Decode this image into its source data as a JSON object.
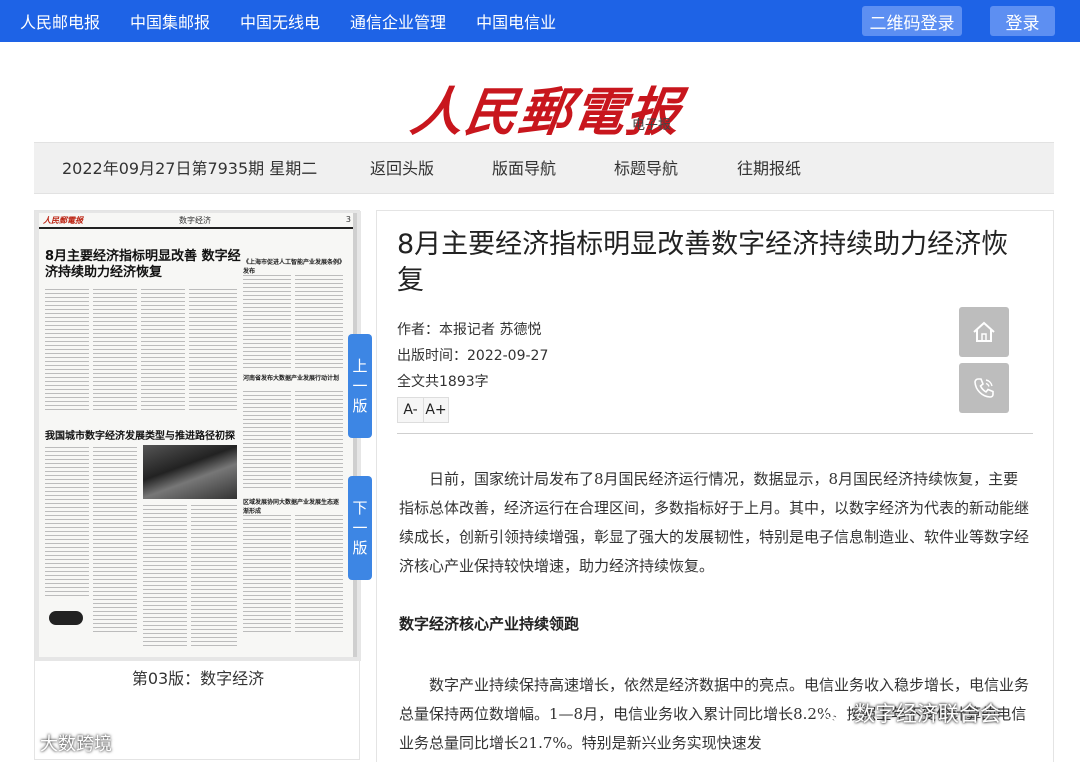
{
  "topnav": {
    "links": [
      "人民邮电报",
      "中国集邮报",
      "中国无线电",
      "通信企业管理",
      "中国电信业"
    ],
    "qr_login": "二维码登录",
    "login": "登录"
  },
  "masthead": {
    "logo": "人民郵電报",
    "subtitle": "电子报"
  },
  "subnav": {
    "issue": "2022年09月27日第7935期 星期二",
    "back_home": "返回头版",
    "layout_nav": "版面导航",
    "title_nav": "标题导航",
    "archive": "往期报纸"
  },
  "newspaper": {
    "section": "数字经济",
    "page_no": "3",
    "headline": "8月主要经济指标明显改善 数字经济持续助力经济恢复",
    "headline2": "我国城市数字经济发展类型与推进路径初探",
    "right_title1": "《上海市促进人工智能产业发展条例》发布",
    "right_title2": "河南省发布大数据产业发展行动计划",
    "right_title3": "区域发展协同大数据产业发展生态逐渐形成",
    "page_label": "第03版：数字经济",
    "prev": "上一版",
    "next": "下一版"
  },
  "article": {
    "title": "8月主要经济指标明显改善数字经济持续助力经济恢复",
    "author": "作者：本报记者 苏德悦",
    "date": "出版时间：2022-09-27",
    "count": "全文共1893字",
    "font_minus": "A-",
    "font_plus": "A+",
    "para1": "日前，国家统计局发布了8月国民经济运行情况，数据显示，8月国民经济持续恢复，主要指标总体改善，经济运行在合理区间，多数指标好于上月。其中，以数字经济为代表的新动能继续成长，创新引领持续增强，彰显了强大的发展韧性，特别是电子信息制造业、软件业等数字经济核心产业保持较快增速，助力经济持续恢复。",
    "subhead": "数字经济核心产业持续领跑",
    "para2": "数字产业持续保持高速增长，依然是经济数据中的亮点。电信业务收入稳步增长，电信业务总量保持两位数增幅。1—8月，电信业务收入累计同比增长8.2%。按照上年不变价计算的电信业务总量同比增长21.7%。特别是新兴业务实现快速发"
  },
  "watermarks": {
    "right": "数字经济联合会",
    "left": "大数跨境"
  },
  "colors": {
    "topbar": "#1e63e6",
    "accent_tab": "#3d86e4",
    "logo_red": "#c8161d"
  }
}
